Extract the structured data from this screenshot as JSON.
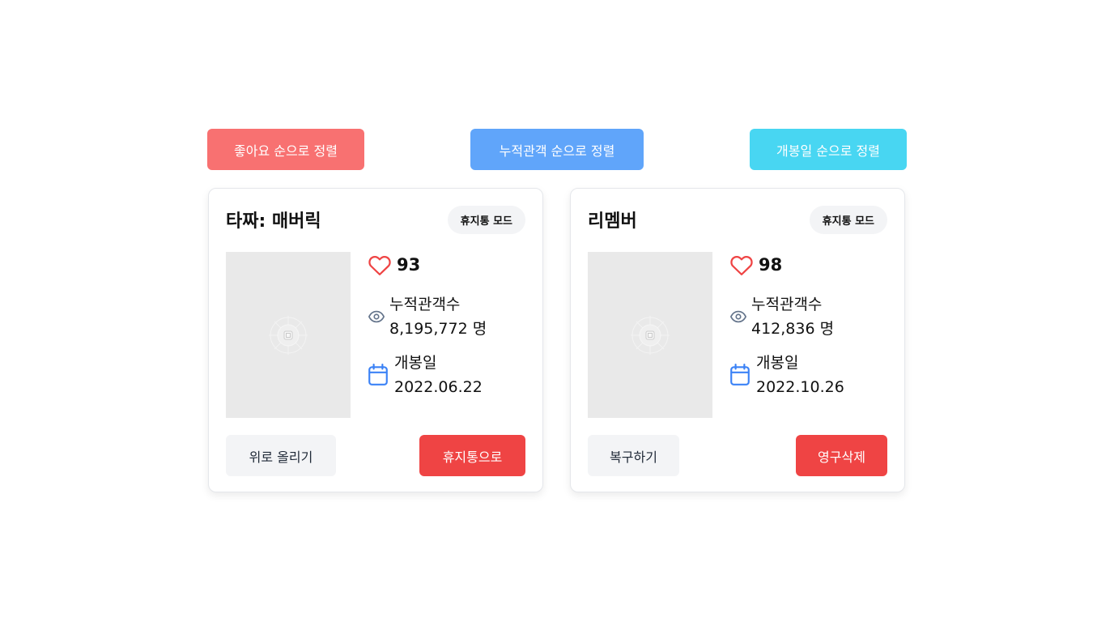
{
  "sort_bar": {
    "likes_label": "좋아요 순으로 정렬",
    "audience_label": "누적관객 순으로 정렬",
    "release_label": "개봉일 순으로 정렬"
  },
  "colors": {
    "likes_button": "#f87171",
    "audience_button": "#60a5fa",
    "release_button": "#48d6f2",
    "danger": "#ef4444",
    "heart_icon": "#ef4444",
    "calendar_icon": "#3b82f6",
    "eye_icon": "#64748b"
  },
  "cards": [
    {
      "title": "타짜: 매버릭",
      "mode_badge": "휴지통 모드",
      "likes": "93",
      "audience_label": "누적관객수",
      "audience_value": "8,195,772 명",
      "release_label": "개봉일",
      "release_date": "2022.06.22",
      "secondary_action": "위로 올리기",
      "danger_action": "휴지통으로",
      "icons": [
        "heart-icon",
        "eye-icon",
        "calendar-icon",
        "image-placeholder-icon"
      ]
    },
    {
      "title": "리멤버",
      "mode_badge": "휴지통 모드",
      "likes": "98",
      "audience_label": "누적관객수",
      "audience_value": "412,836 명",
      "release_label": "개봉일",
      "release_date": "2022.10.26",
      "secondary_action": "복구하기",
      "danger_action": "영구삭제",
      "icons": [
        "heart-icon",
        "eye-icon",
        "calendar-icon",
        "image-placeholder-icon"
      ]
    }
  ]
}
